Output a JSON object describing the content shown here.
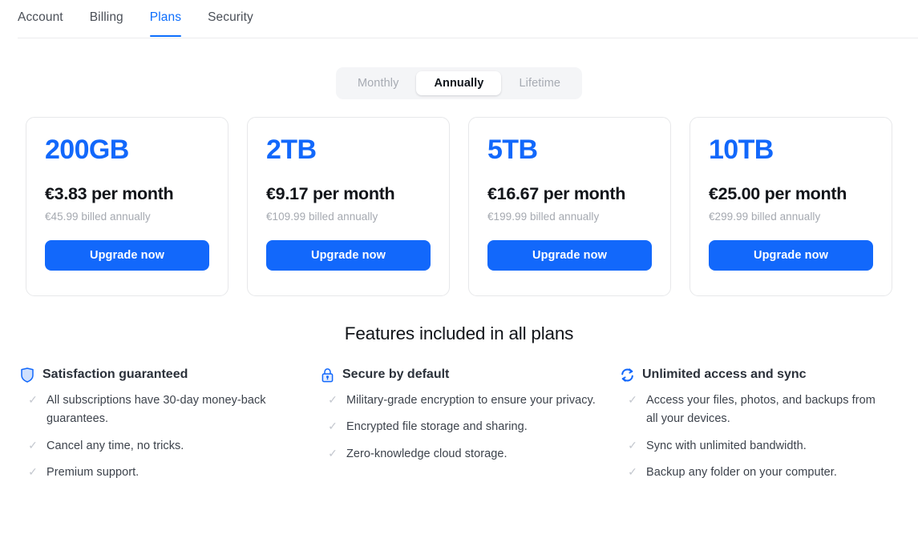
{
  "tabs": [
    {
      "label": "Account",
      "active": false
    },
    {
      "label": "Billing",
      "active": false
    },
    {
      "label": "Plans",
      "active": true
    },
    {
      "label": "Security",
      "active": false
    }
  ],
  "billing_toggle": {
    "options": [
      "Monthly",
      "Annually",
      "Lifetime"
    ],
    "selected": "Annually"
  },
  "plans": [
    {
      "size": "200GB",
      "price": "€3.83 per month",
      "billed": "€45.99 billed annually",
      "cta": "Upgrade now"
    },
    {
      "size": "2TB",
      "price": "€9.17 per month",
      "billed": "€109.99 billed annually",
      "cta": "Upgrade now"
    },
    {
      "size": "5TB",
      "price": "€16.67 per month",
      "billed": "€199.99 billed annually",
      "cta": "Upgrade now"
    },
    {
      "size": "10TB",
      "price": "€25.00 per month",
      "billed": "€299.99 billed annually",
      "cta": "Upgrade now"
    }
  ],
  "features": {
    "title": "Features included in all plans",
    "columns": [
      {
        "icon": "shield-icon",
        "title": "Satisfaction guaranteed",
        "items": [
          "All subscriptions have 30-day money-back guarantees.",
          "Cancel any time, no tricks.",
          "Premium support."
        ]
      },
      {
        "icon": "lock-icon",
        "title": "Secure by default",
        "items": [
          "Military-grade encryption to ensure your privacy.",
          "Encrypted file storage and sharing.",
          "Zero-knowledge cloud storage."
        ]
      },
      {
        "icon": "sync-icon",
        "title": "Unlimited access and sync",
        "items": [
          "Access your files, photos, and backups from all your devices.",
          "Sync with unlimited bandwidth.",
          "Backup any folder on your computer."
        ]
      }
    ],
    "check_glyph": "✓"
  },
  "colors": {
    "accent": "#1268fb",
    "tab_active": "#0d6efd",
    "text": "#12151a",
    "muted": "#a5a9b0",
    "border": "#e7e8ea",
    "toggle_bg": "#f4f5f7"
  }
}
